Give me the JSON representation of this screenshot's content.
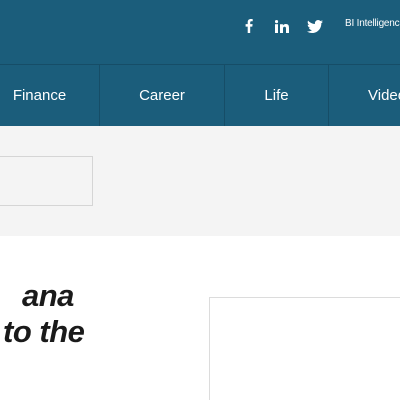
{
  "header": {
    "social": {
      "facebook_icon": "facebook-icon",
      "linkedin_icon": "linkedin-icon",
      "twitter_icon": "twitter-icon"
    },
    "bi_link": "BI Intelligence"
  },
  "nav": {
    "items": [
      {
        "label": "Finance"
      },
      {
        "label": "Career"
      },
      {
        "label": "Life"
      },
      {
        "label": "Video"
      }
    ]
  },
  "article": {
    "headline_line1": "ana",
    "headline_line2": "to the"
  },
  "colors": {
    "header_bg": "#1b5d7b",
    "band_bg": "#f4f4f4",
    "text_dark": "#1a1a1a"
  }
}
